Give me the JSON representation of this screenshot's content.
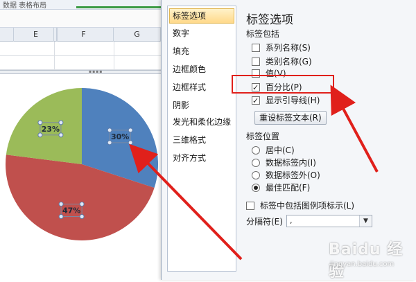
{
  "excel": {
    "ribbon_text": "数据 表格布局",
    "columns": [
      "E",
      "F",
      "G"
    ]
  },
  "chart_data": {
    "type": "pie",
    "categories": [
      "",
      "",
      ""
    ],
    "values": [
      30,
      47,
      23
    ],
    "data_labels": [
      "30%",
      "47%",
      "23%"
    ],
    "colors": [
      "#4f81bd",
      "#c0504d",
      "#9bbb59"
    ],
    "title": ""
  },
  "dialog": {
    "nav_items": [
      "标签选项",
      "数字",
      "填充",
      "边框颜色",
      "边框样式",
      "阴影",
      "发光和柔化边缘",
      "三维格式",
      "对齐方式"
    ],
    "panel_title": "标签选项",
    "contains_label": "标签包括",
    "options": [
      {
        "label": "系列名称(S)",
        "checked": false
      },
      {
        "label": "类别名称(G)",
        "checked": false
      },
      {
        "label": "值(V)",
        "checked": false
      },
      {
        "label": "百分比(P)",
        "checked": true
      },
      {
        "label": "显示引导线(H)",
        "checked": true
      }
    ],
    "reset_button": "重设标签文本(R)",
    "position_label": "标签位置",
    "positions": [
      {
        "label": "居中(C)",
        "checked": false
      },
      {
        "label": "数据标签内(I)",
        "checked": false
      },
      {
        "label": "数据标签外(O)",
        "checked": false
      },
      {
        "label": "最佳匹配(F)",
        "checked": true
      }
    ],
    "legend_key_label": "标签中包括图例项标示(L)",
    "separator_label": "分隔符(E)",
    "separator_value": ","
  },
  "watermark": {
    "brand": "Baidu 经验",
    "url": "jingyan.baidu.com"
  }
}
